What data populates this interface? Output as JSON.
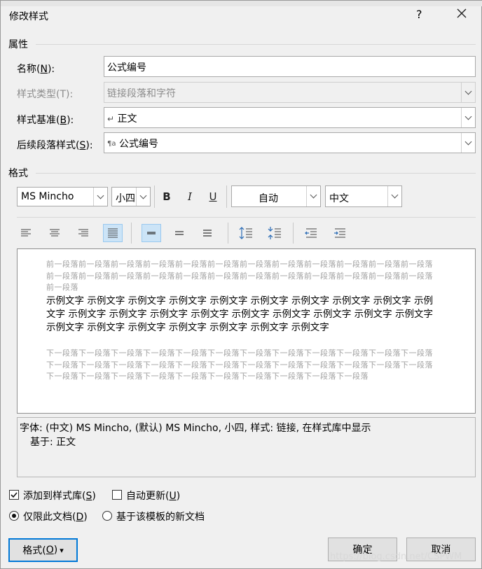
{
  "dialog": {
    "title": "修改样式",
    "help": "?"
  },
  "properties": {
    "section": "属性",
    "name_label": "名称(",
    "name_key": "N",
    "name_suffix": "):",
    "name_value": "公式编号",
    "type_label": "样式类型(T):",
    "type_value": "链接段落和字符",
    "base_label": "样式基准(",
    "base_key": "B",
    "base_suffix": "):",
    "base_icon": "↵",
    "base_value": "正文",
    "next_label": "后续段落样式(",
    "next_key": "S",
    "next_suffix": "):",
    "next_icon": "¶a",
    "next_value": "公式编号"
  },
  "format": {
    "section": "格式",
    "font": "MS Mincho",
    "size": "小四",
    "bold": "B",
    "italic": "I",
    "underline": "U",
    "color": "自动",
    "lang": "中文"
  },
  "preview": {
    "before": "前一段落前一段落前一段落前一段落前一段落前一段落前一段落前一段落前一段落前一段落前一段落前一段落前一段落前一段落前一段落前一段落前一段落前一段落前一段落前一段落前一段落前一段落前一段落前一段落前一段落",
    "sample": "示例文字 示例文字 示例文字 示例文字 示例文字 示例文字 示例文字 示例文字 示例文字 示例文字 示例文字 示例文字 示例文字 示例文字 示例文字 示例文字 示例文字 示例文字 示例文字 示例文字 示例文字 示例文字 示例文字 示例文字 示例文字 示例文字",
    "after": "下一段落下一段落下一段落下一段落下一段落下一段落下一段落下一段落下一段落下一段落下一段落下一段落下一段落下一段落下一段落下一段落下一段落下一段落下一段落下一段落下一段落下一段落下一段落下一段落下一段落下一段落下一段落下一段落下一段落下一段落下一段落下一段落下一段落下一段落"
  },
  "description": {
    "line1": "字体: (中文) MS Mincho, (默认) MS Mincho, 小四, 样式: 链接, 在样式库中显示",
    "line2": "基于: 正文"
  },
  "options": {
    "add_gallery_label": "添加到样式库(",
    "add_gallery_key": "S",
    "add_gallery_suffix": ")",
    "add_gallery_checked": true,
    "auto_update_label": "自动更新(",
    "auto_update_key": "U",
    "auto_update_suffix": ")",
    "auto_update_checked": false,
    "only_doc_label": "仅限此文档(",
    "only_doc_key": "D",
    "only_doc_suffix": ")",
    "template_label": "基于该模板的新文档"
  },
  "buttons": {
    "format_label": "格式(",
    "format_key": "O",
    "format_suffix": ")",
    "format_arrow": "▾",
    "ok": "确定",
    "cancel": "取消"
  },
  "watermark": "https://blog.csdn.net/CSPWM"
}
